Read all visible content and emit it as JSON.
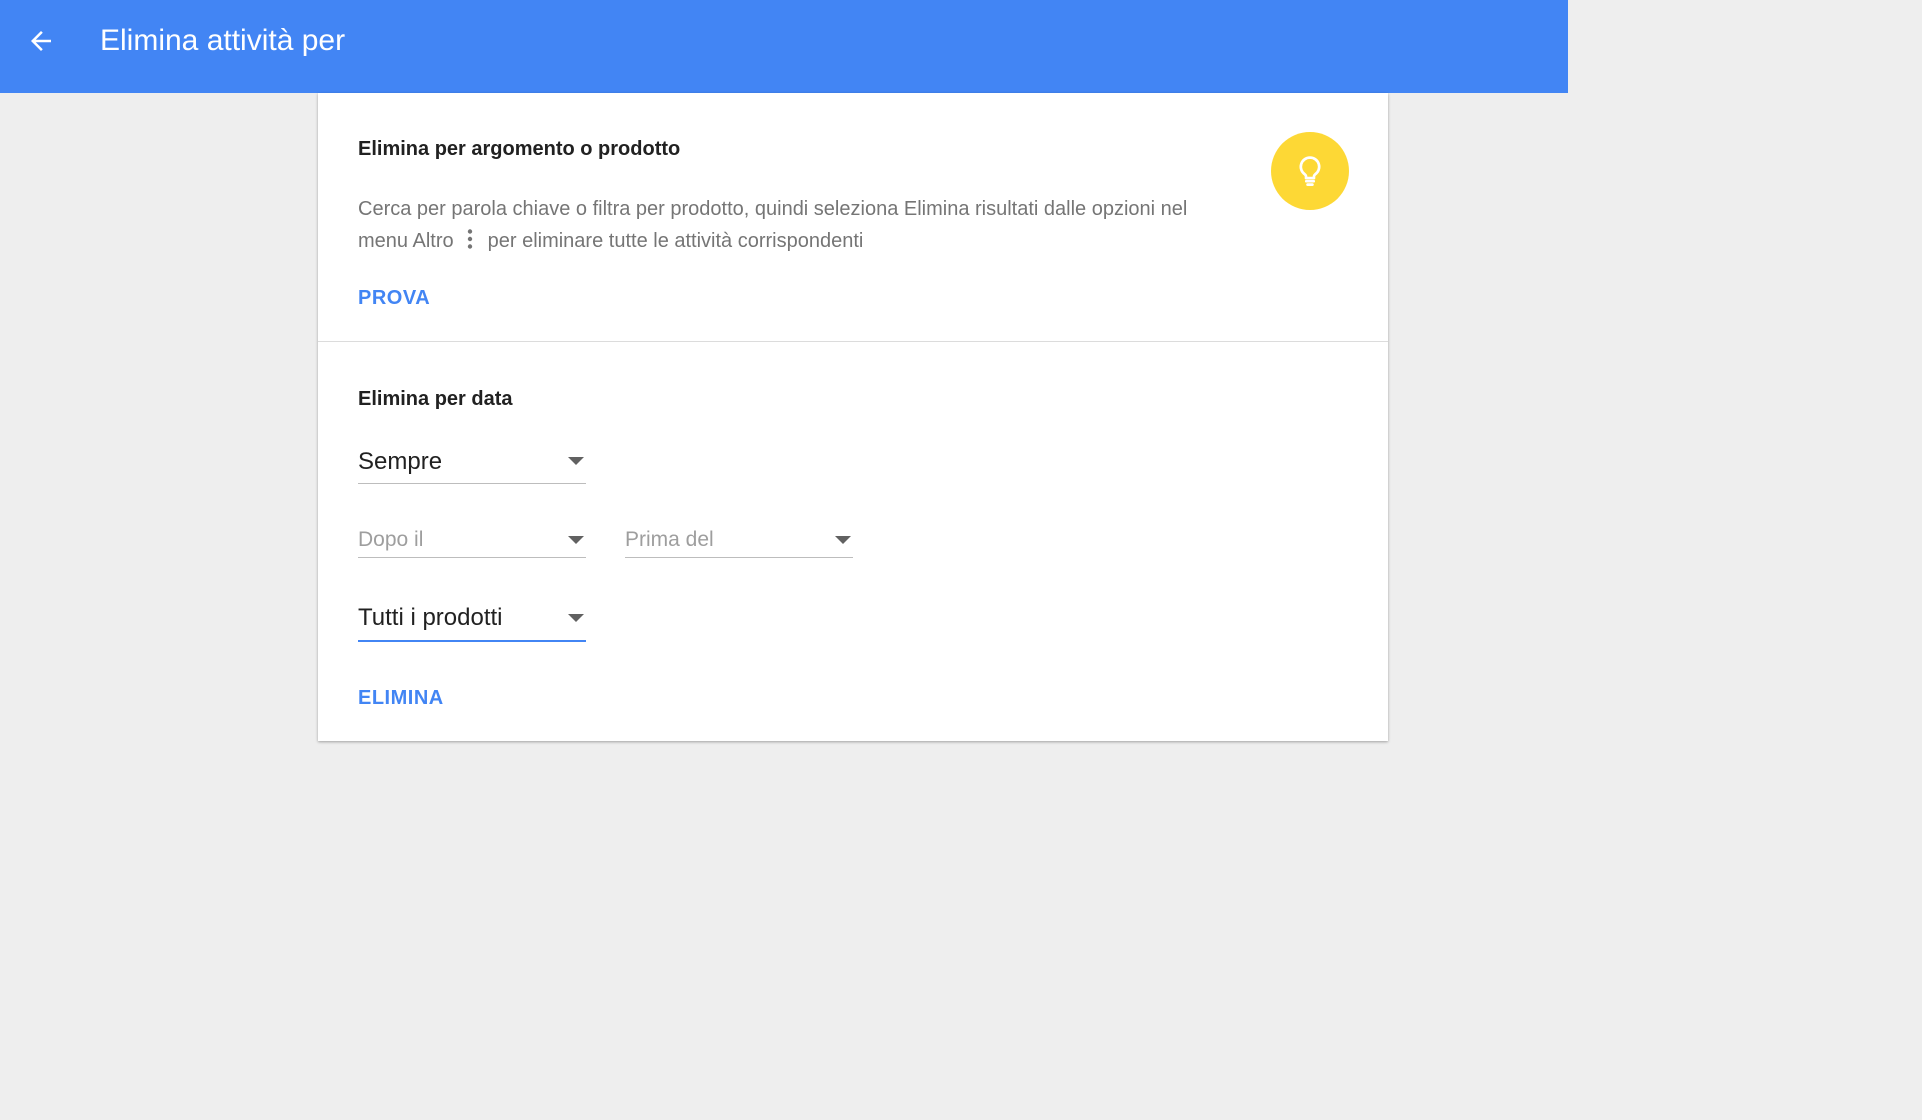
{
  "header": {
    "title": "Elimina attività per",
    "back_icon": "arrow-left-icon",
    "background": "#4285f4"
  },
  "topic_section": {
    "title": "Elimina per argomento o prodotto",
    "description_before_icon": "Cerca per parola chiave o filtra per prodotto, quindi seleziona Elimina risultati dalle opzioni nel menu Altro",
    "more_icon": "more-vert-icon",
    "description_after_icon": "per eliminare tutte le attività corrispondenti",
    "action_label": "PROVA",
    "badge_icon": "lightbulb-icon",
    "badge_color": "#fdd835"
  },
  "date_section": {
    "title": "Elimina per data",
    "range_select": {
      "value": "Sempre"
    },
    "after_select": {
      "placeholder": "Dopo il"
    },
    "before_select": {
      "placeholder": "Prima del"
    },
    "product_select": {
      "value": "Tutti i prodotti"
    },
    "action_label": "ELIMINA"
  },
  "colors": {
    "accent": "#4285f4",
    "page_background": "#eeeeee"
  }
}
